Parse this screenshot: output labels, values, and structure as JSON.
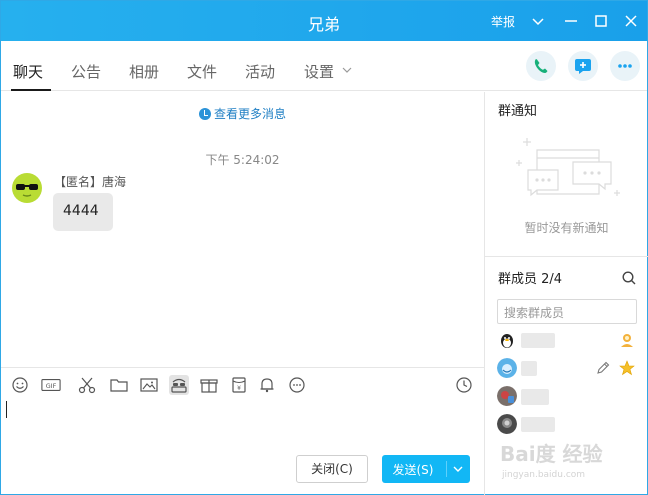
{
  "window": {
    "title": "兄弟",
    "report_label": "举报"
  },
  "tabs": [
    {
      "label": "聊天"
    },
    {
      "label": "公告"
    },
    {
      "label": "相册"
    },
    {
      "label": "文件"
    },
    {
      "label": "活动"
    },
    {
      "label": "设置"
    }
  ],
  "chat": {
    "more_messages": "查看更多消息",
    "timestamp": "下午 5:24:02",
    "message": {
      "sender": "【匿名】唐海",
      "text": "4444"
    }
  },
  "buttons": {
    "close": "关闭(C)",
    "send": "发送(S)"
  },
  "sidebar": {
    "notice_title": "群通知",
    "notice_empty": "暂时没有新通知",
    "members_title": "群成员 2/4",
    "member_search_placeholder": "搜索群成员",
    "member_count": 4
  },
  "colors": {
    "titlebar": "#1fa6ec",
    "send_button": "#12b7f5",
    "link": "#1f7fc4"
  },
  "watermark": {
    "text_cn": "Bai度 经验",
    "text_url": "jingyan.baidu.com"
  }
}
